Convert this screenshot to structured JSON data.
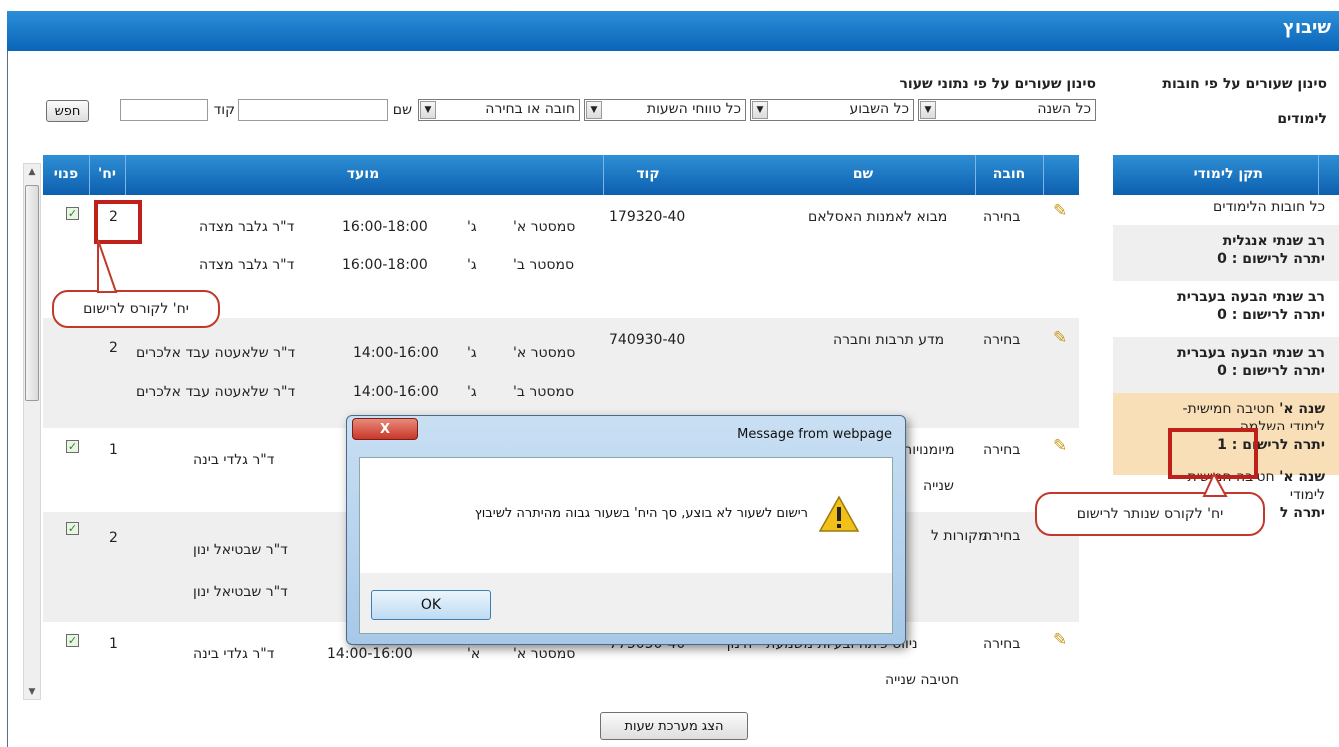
{
  "header": {
    "title": "שיבוץ"
  },
  "side_filter": {
    "title_line1": "סינון שעורים על פי חובות",
    "title_line2": "לימודים",
    "table_header": "תקן לימודי",
    "items": [
      {
        "title": "כל חובות הלימודים",
        "sub": ""
      },
      {
        "title": "רב שנתי אנגלית",
        "sub": "יתרה לרישום : 0"
      },
      {
        "title": "רב שנתי הבעה בעברית",
        "sub": "יתרה לרישום : 0"
      },
      {
        "title": "רב שנתי הבעה בעברית",
        "sub": "יתרה לרישום : 0"
      },
      {
        "title_bold": "שנה א'",
        "title": " חטיבה חמישית-",
        "line2": "לימודי השלמה",
        "sub": "יתרה לרישום : 1"
      },
      {
        "title_bold": "שנה א'",
        "title": " חטיבה חמישית-",
        "line2": "לימודי",
        "sub": "יתרה ל"
      }
    ]
  },
  "filters": {
    "title": "סינון שעורים על פי נתוני שעור",
    "year_select": "כל השנה",
    "week_select": "כל השבוע",
    "hours_select": "כל טווחי השעות",
    "type_select": "חובה או בחירה",
    "name_label": "שם",
    "code_label": "קוד",
    "search_button": "חפש"
  },
  "table": {
    "headers": {
      "obligation": "חובה",
      "name": "שם",
      "code": "קוד",
      "time": "מועד",
      "units": "יח'",
      "free": "פנוי"
    },
    "rows": [
      {
        "obligation": "בחירה",
        "name": "מבוא לאמנות האסלאם",
        "code": "179320-40",
        "units": "2",
        "sessions": [
          {
            "semester": "סמסטר א'",
            "day": "ג'",
            "hours": "16:00-18:00",
            "lecturer": "ד\"ר גלבר מצדה"
          },
          {
            "semester": "סמסטר ב'",
            "day": "ג'",
            "hours": "16:00-18:00",
            "lecturer": "ד\"ר גלבר מצדה"
          }
        ]
      },
      {
        "obligation": "בחירה",
        "name": "מדע תרבות וחברה",
        "code": "740930-40",
        "units": "2",
        "sessions": [
          {
            "semester": "סמסטר א'",
            "day": "ג'",
            "hours": "14:00-16:00",
            "lecturer": "ד\"ר שלאעטה עבד אלכרים"
          },
          {
            "semester": "סמסטר ב'",
            "day": "ג'",
            "hours": "14:00-16:00",
            "lecturer": "ד\"ר שלאעטה עבד אלכרים"
          }
        ]
      },
      {
        "obligation": "בחירה",
        "name": "מיומנויות",
        "name_line2": "שנייה",
        "units": "1",
        "sessions": [
          {
            "lecturer": "ד\"ר גלדי בינה"
          }
        ]
      },
      {
        "obligation": "בחירה",
        "name": "מקורות ל",
        "units": "2",
        "sessions": [
          {
            "lecturer": "ד\"ר שבטיאל ינון"
          },
          {
            "lecturer": "ד\"ר שבטיאל ינון"
          }
        ]
      },
      {
        "obligation": "בחירה",
        "name": "ניווט כיתה ובעיות משמעת - חינוך",
        "name_line2": "חטיבה שנייה",
        "code": "775050-40",
        "units": "1",
        "sessions": [
          {
            "semester": "סמסטר א'",
            "day": "א'",
            "hours": "14:00-16:00",
            "lecturer": "ד\"ר גלדי בינה"
          }
        ]
      }
    ],
    "show_schedule_button": "הצג מערכת שעות"
  },
  "callouts": {
    "units_to_register": "יח' לקורס לרישום",
    "units_remaining": "יח' לקורס שנותר לרישום"
  },
  "dialog": {
    "title": "Message from webpage",
    "close_label": "X",
    "message": "רישום לשעור לא בוצע, סך היח' בשעור גבוה מהיתרה לשיבוץ",
    "ok_label": "OK"
  },
  "colors": {
    "header_blue": "#0a64b8",
    "highlight": "#f9dfb8",
    "callout_red": "#c0201a"
  }
}
